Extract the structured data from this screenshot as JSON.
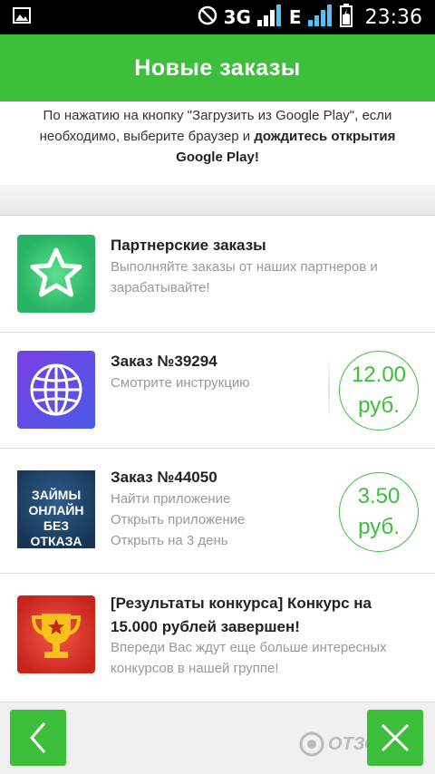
{
  "status_bar": {
    "network_3g": "3G",
    "network_e": "E",
    "time": "23:36"
  },
  "header": {
    "title": "Новые заказы"
  },
  "notice": {
    "line1": "По нажатию на кнопку \"Загрузить из Google Play\", если",
    "line2_regular": "необходимо, выберите браузер и ",
    "line2_bold": "дождитесь открытия",
    "line3_bold": "Google Play!"
  },
  "items": [
    {
      "title": "Партнерские заказы",
      "lines": [
        "Выполняйте заказы от наших партнеров и",
        "зарабатывайте!"
      ],
      "icon": "star-icon"
    },
    {
      "title": "Заказ №39294",
      "lines": [
        "Смотрите инструкцию"
      ],
      "price_amount": "12.00",
      "price_currency": "руб.",
      "icon": "globe-icon"
    },
    {
      "title": "Заказ №44050",
      "lines": [
        "Найти приложение",
        "Открыть приложение",
        "Открыть на 3 день"
      ],
      "thumb_text": [
        "ЗАЙМЫ",
        "ОНЛАЙН",
        "БЕЗ ОТКАЗА"
      ],
      "price_amount": "3.50",
      "price_currency": "руб.",
      "icon": "loan-app-icon"
    },
    {
      "title_line1": "[Результаты  конкурса] Конкурс на",
      "title_line2": "15.000 рублей завершен!",
      "lines": [
        "Впереди Вас ждут еще больше интересных",
        "конкурсов в нашей группе!"
      ],
      "icon": "trophy-icon"
    }
  ],
  "watermark": "ОТЗОВИК",
  "colors": {
    "accent": "#3dbf3b",
    "status_bar": "#000000"
  }
}
